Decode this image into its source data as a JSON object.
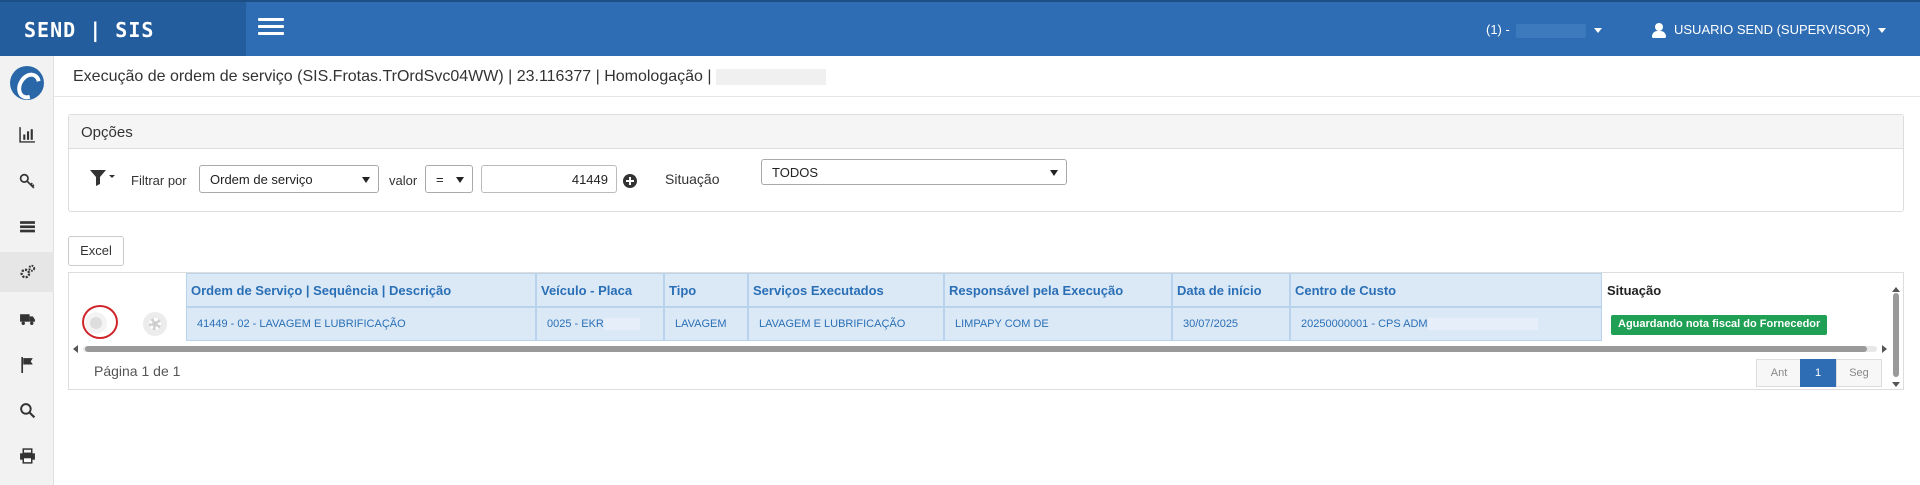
{
  "header": {
    "brand": "SEND | SIS",
    "company_label": "(1) -",
    "user_label": "USUARIO SEND (SUPERVISOR)"
  },
  "page": {
    "title": "Execução de ordem de serviço (SIS.Frotas.TrOrdSvc04WW) | 23.116377 | Homologação |"
  },
  "options": {
    "panel_title": "Opções",
    "filter_by_label": "Filtrar por",
    "filter_field_value": "Ordem de serviço",
    "value_label": "valor",
    "operator_value": "=",
    "filter_input_value": "41449",
    "situation_label": "Situação",
    "situation_value": "TODOS"
  },
  "toolbar": {
    "excel_label": "Excel"
  },
  "grid": {
    "columns": [
      "Ordem de Serviço | Sequência | Descrição",
      "Veículo - Placa",
      "Tipo",
      "Serviços Executados",
      "Responsável pela Execução",
      "Data de início",
      "Centro de Custo",
      "Situação"
    ],
    "rows": [
      {
        "ordem": "41449 - 02 - LAVAGEM E LUBRIFICAÇÃO",
        "veiculo": "0025 - EKR",
        "tipo": "LAVAGEM",
        "servicos": "LAVAGEM E LUBRIFICAÇÃO",
        "responsavel": "LIMPAPY COM DE",
        "data_inicio": "30/07/2025",
        "centro_custo": "20250000001 - CPS ADM",
        "situacao": "Aguardando nota fiscal do Fornecedor"
      }
    ]
  },
  "pager": {
    "label": "Página 1 de 1",
    "prev": "Ant",
    "current": "1",
    "next": "Seg"
  },
  "colors": {
    "topbar": "#2e6db3",
    "header_cell": "#dbe9f7",
    "header_text": "#2a6fb5",
    "status_badge": "#1fa055"
  },
  "icons": {
    "sidebar": [
      "chart-icon",
      "key-icon",
      "list-icon",
      "gears-icon",
      "truck-icon",
      "flag-icon",
      "search-icon",
      "print-icon"
    ]
  }
}
